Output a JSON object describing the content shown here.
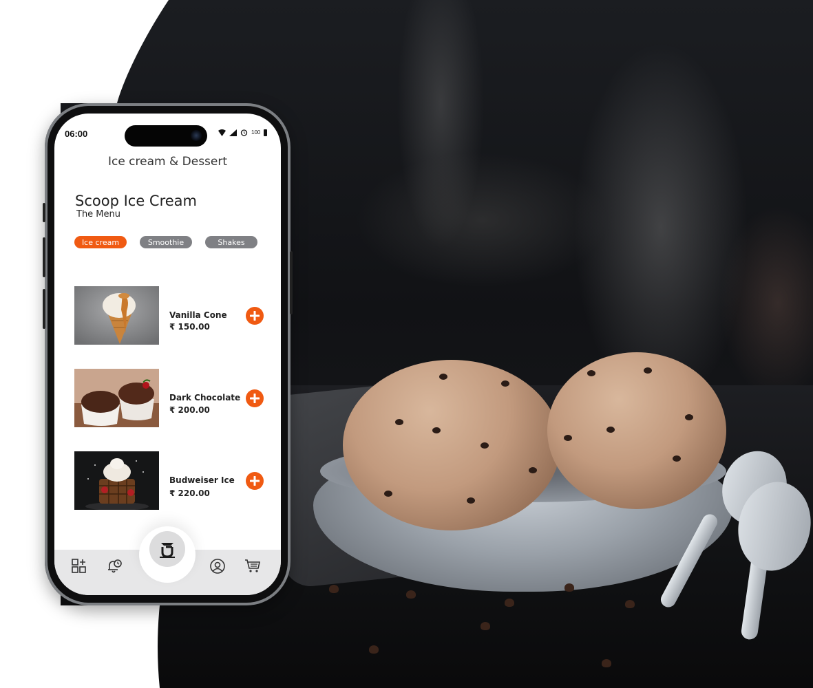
{
  "status_bar": {
    "time": "06:00",
    "battery": "100"
  },
  "app": {
    "title": "Ice cream & Dessert"
  },
  "menu": {
    "title": "Scoop Ice Cream",
    "subtitle": "The Menu"
  },
  "tabs": [
    {
      "label": "Ice cream",
      "active": true
    },
    {
      "label": "Smoothie",
      "active": false
    },
    {
      "label": "Shakes",
      "active": false
    }
  ],
  "items": [
    {
      "name": "Vanilla Cone",
      "price": "₹ 150.00"
    },
    {
      "name": "Dark Chocolate",
      "price": "₹ 200.00"
    },
    {
      "name": "Budweiser Ice",
      "price": "₹ 220.00"
    }
  ],
  "bottom_nav": [
    "grid-add-icon",
    "bell-clock-icon",
    "brand-logo-icon",
    "user-icon",
    "cart-icon"
  ],
  "colors": {
    "accent": "#f05a12",
    "tab_inactive": "#7f8084",
    "nav_bg": "#e7e7e8"
  }
}
